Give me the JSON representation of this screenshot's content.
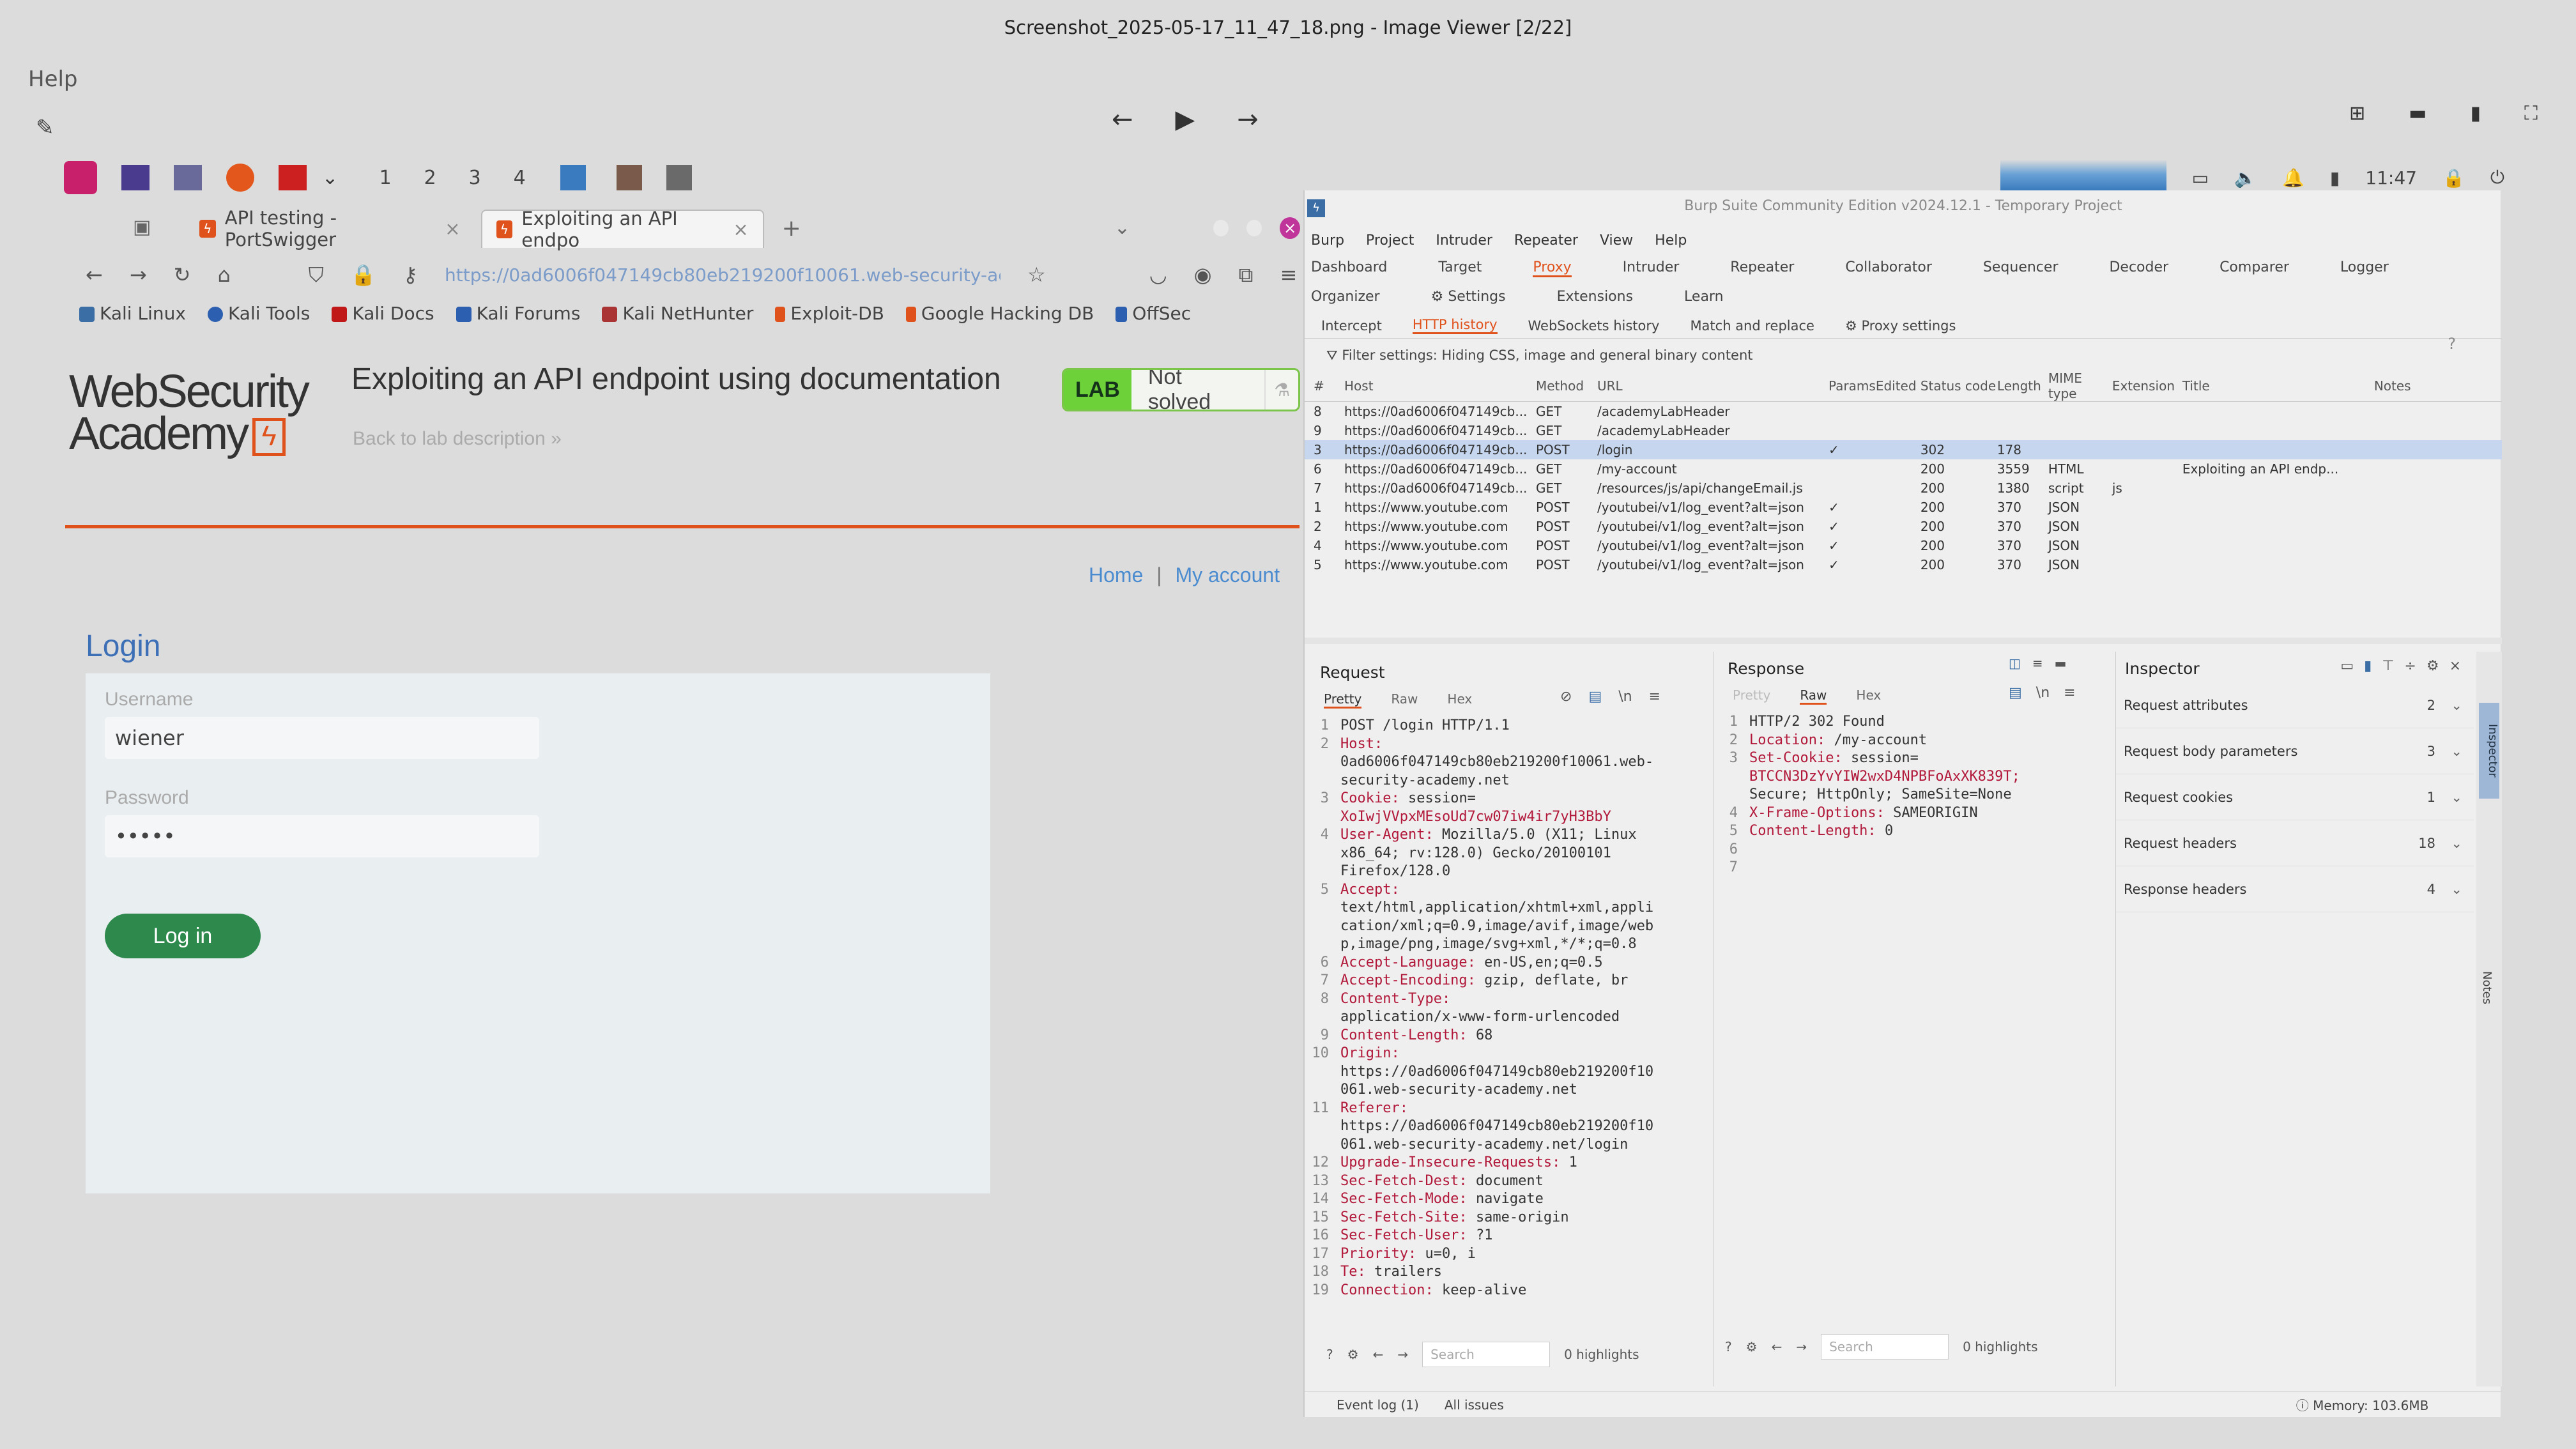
{
  "viewer": {
    "title": "Screenshot_2025-05-17_11_47_18.png - Image Viewer [2/22]",
    "menu_help": "Help"
  },
  "kali_panel": {
    "workspaces": [
      "1",
      "2",
      "3",
      "4"
    ],
    "clock": "11:47"
  },
  "firefox": {
    "tabs": [
      {
        "label": "API testing - PortSwigger"
      },
      {
        "label": "Exploiting an API endpo"
      }
    ],
    "url": "https://0ad6006f047149cb80eb219200f10061.web-security-ac",
    "bookmarks": [
      "Kali Linux",
      "Kali Tools",
      "Kali Docs",
      "Kali Forums",
      "Kali NetHunter",
      "Exploit-DB",
      "Google Hacking DB",
      "OffSec"
    ]
  },
  "lab": {
    "logo_line1": "WebSecurity",
    "logo_line2": "Academy",
    "title": "Exploiting an API endpoint using documentation",
    "badge": "LAB",
    "status": "Not solved",
    "back": "Back to lab description",
    "nav_home": "Home",
    "nav_sep": "|",
    "nav_account": "My account",
    "login_heading": "Login",
    "username_label": "Username",
    "username_value": "wiener",
    "password_label": "Password",
    "password_value": "•••••",
    "login_button": "Log in"
  },
  "burp": {
    "title": "Burp Suite Community Edition v2024.12.1 - Temporary Project",
    "menu": [
      "Burp",
      "Project",
      "Intruder",
      "Repeater",
      "View",
      "Help"
    ],
    "tabs": [
      "Dashboard",
      "Target",
      "Proxy",
      "Intruder",
      "Repeater",
      "Collaborator",
      "Sequencer",
      "Decoder",
      "Comparer",
      "Logger",
      "Organizer",
      "Settings",
      "Extensions",
      "Learn"
    ],
    "active_tab": "Proxy",
    "subtabs": [
      "Intercept",
      "HTTP history",
      "WebSockets history",
      "Match and replace",
      "Proxy settings"
    ],
    "filter": "Filter settings: Hiding CSS, image and general binary content",
    "columns": [
      "#",
      "Host",
      "Method",
      "URL",
      "Params",
      "Edited",
      "Status code",
      "Length",
      "MIME type",
      "Extension",
      "Title",
      "Notes"
    ],
    "rows": [
      {
        "n": "8",
        "host": "https://0ad6006f047149cb...",
        "method": "GET",
        "url": "/academyLabHeader",
        "params": "",
        "status": "",
        "length": "",
        "mime": "",
        "ext": "",
        "title": ""
      },
      {
        "n": "9",
        "host": "https://0ad6006f047149cb...",
        "method": "GET",
        "url": "/academyLabHeader",
        "params": "",
        "status": "",
        "length": "",
        "mime": "",
        "ext": "",
        "title": ""
      },
      {
        "n": "3",
        "host": "https://0ad6006f047149cb...",
        "method": "POST",
        "url": "/login",
        "params": "✓",
        "status": "302",
        "length": "178",
        "mime": "",
        "ext": "",
        "title": ""
      },
      {
        "n": "6",
        "host": "https://0ad6006f047149cb...",
        "method": "GET",
        "url": "/my-account",
        "params": "",
        "status": "200",
        "length": "3559",
        "mime": "HTML",
        "ext": "",
        "title": "Exploiting an API endp..."
      },
      {
        "n": "7",
        "host": "https://0ad6006f047149cb...",
        "method": "GET",
        "url": "/resources/js/api/changeEmail.js",
        "params": "",
        "status": "200",
        "length": "1380",
        "mime": "script",
        "ext": "js",
        "title": ""
      },
      {
        "n": "1",
        "host": "https://www.youtube.com",
        "method": "POST",
        "url": "/youtubei/v1/log_event?alt=json",
        "params": "✓",
        "status": "200",
        "length": "370",
        "mime": "JSON",
        "ext": "",
        "title": ""
      },
      {
        "n": "2",
        "host": "https://www.youtube.com",
        "method": "POST",
        "url": "/youtubei/v1/log_event?alt=json",
        "params": "✓",
        "status": "200",
        "length": "370",
        "mime": "JSON",
        "ext": "",
        "title": ""
      },
      {
        "n": "4",
        "host": "https://www.youtube.com",
        "method": "POST",
        "url": "/youtubei/v1/log_event?alt=json",
        "params": "✓",
        "status": "200",
        "length": "370",
        "mime": "JSON",
        "ext": "",
        "title": ""
      },
      {
        "n": "5",
        "host": "https://www.youtube.com",
        "method": "POST",
        "url": "/youtubei/v1/log_event?alt=json",
        "params": "✓",
        "status": "200",
        "length": "370",
        "mime": "JSON",
        "ext": "",
        "title": ""
      }
    ],
    "request": {
      "heading": "Request",
      "tabs": [
        "Pretty",
        "Raw",
        "Hex"
      ],
      "lines": [
        {
          "n": "1",
          "k": "",
          "v": "POST /login HTTP/1.1"
        },
        {
          "n": "2",
          "k": "Host:",
          "v": ""
        },
        {
          "n": "",
          "k": "",
          "v": "0ad6006f047149cb80eb219200f10061.web-"
        },
        {
          "n": "",
          "k": "",
          "v": "security-academy.net"
        },
        {
          "n": "3",
          "k": "Cookie:",
          "v": "session="
        },
        {
          "n": "",
          "k": "",
          "v": "XoIwjVVpxMEsoUd7cw07iw4ir7yH3BbY"
        },
        {
          "n": "4",
          "k": "User-Agent:",
          "v": "Mozilla/5.0 (X11; Linux"
        },
        {
          "n": "",
          "k": "",
          "v": "x86_64; rv:128.0) Gecko/20100101"
        },
        {
          "n": "",
          "k": "",
          "v": "Firefox/128.0"
        },
        {
          "n": "5",
          "k": "Accept:",
          "v": ""
        },
        {
          "n": "",
          "k": "",
          "v": "text/html,application/xhtml+xml,appli"
        },
        {
          "n": "",
          "k": "",
          "v": "cation/xml;q=0.9,image/avif,image/web"
        },
        {
          "n": "",
          "k": "",
          "v": "p,image/png,image/svg+xml,*/*;q=0.8"
        },
        {
          "n": "6",
          "k": "Accept-Language:",
          "v": "en-US,en;q=0.5"
        },
        {
          "n": "7",
          "k": "Accept-Encoding:",
          "v": "gzip, deflate, br"
        },
        {
          "n": "8",
          "k": "Content-Type:",
          "v": ""
        },
        {
          "n": "",
          "k": "",
          "v": "application/x-www-form-urlencoded"
        },
        {
          "n": "9",
          "k": "Content-Length:",
          "v": "68"
        },
        {
          "n": "10",
          "k": "Origin:",
          "v": ""
        },
        {
          "n": "",
          "k": "",
          "v": "https://0ad6006f047149cb80eb219200f10"
        },
        {
          "n": "",
          "k": "",
          "v": "061.web-security-academy.net"
        },
        {
          "n": "11",
          "k": "Referer:",
          "v": ""
        },
        {
          "n": "",
          "k": "",
          "v": "https://0ad6006f047149cb80eb219200f10"
        },
        {
          "n": "",
          "k": "",
          "v": "061.web-security-academy.net/login"
        },
        {
          "n": "12",
          "k": "Upgrade-Insecure-Requests:",
          "v": "1"
        },
        {
          "n": "13",
          "k": "Sec-Fetch-Dest:",
          "v": "document"
        },
        {
          "n": "14",
          "k": "Sec-Fetch-Mode:",
          "v": "navigate"
        },
        {
          "n": "15",
          "k": "Sec-Fetch-Site:",
          "v": "same-origin"
        },
        {
          "n": "16",
          "k": "Sec-Fetch-User:",
          "v": "?1"
        },
        {
          "n": "17",
          "k": "Priority:",
          "v": "u=0, i"
        },
        {
          "n": "18",
          "k": "Te:",
          "v": "trailers"
        },
        {
          "n": "19",
          "k": "Connection:",
          "v": "keep-alive"
        }
      ],
      "search_placeholder": "Search",
      "highlights": "0 highlights"
    },
    "response": {
      "heading": "Response",
      "tabs": [
        "Pretty",
        "Raw",
        "Hex"
      ],
      "lines": [
        {
          "n": "1",
          "k": "",
          "v": "HTTP/2 302 Found"
        },
        {
          "n": "2",
          "k": "Location:",
          "v": "/my-account"
        },
        {
          "n": "3",
          "k": "Set-Cookie:",
          "v": "session="
        },
        {
          "n": "",
          "k": "",
          "v": "BTCCN3DzYvYIW2wxD4NPBFoAxXK839T;"
        },
        {
          "n": "",
          "k": "",
          "v": "Secure; HttpOnly; SameSite=None"
        },
        {
          "n": "4",
          "k": "X-Frame-Options:",
          "v": "SAMEORIGIN"
        },
        {
          "n": "5",
          "k": "Content-Length:",
          "v": "0"
        },
        {
          "n": "6",
          "k": "",
          "v": ""
        },
        {
          "n": "7",
          "k": "",
          "v": ""
        }
      ],
      "search_placeholder": "Search",
      "highlights": "0 highlights"
    },
    "inspector": {
      "heading": "Inspector",
      "rows": [
        {
          "label": "Request attributes",
          "count": "2"
        },
        {
          "label": "Request body parameters",
          "count": "3"
        },
        {
          "label": "Request cookies",
          "count": "1"
        },
        {
          "label": "Request headers",
          "count": "18"
        },
        {
          "label": "Response headers",
          "count": "4"
        }
      ],
      "side_labels": [
        "Inspector",
        "Notes"
      ]
    },
    "footer": {
      "event_log": "Event log (1)",
      "all_issues": "All issues",
      "memory": "Memory: 103.6MB"
    }
  }
}
